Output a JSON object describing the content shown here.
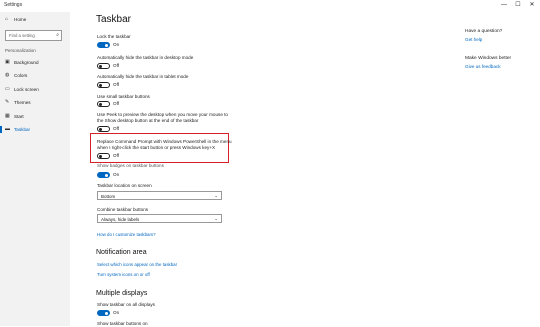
{
  "window": {
    "title": "Settings",
    "minimize": "—",
    "maximize": "☐",
    "close": "✕"
  },
  "sidebar": {
    "home": {
      "icon": "home-icon",
      "label": "Home"
    },
    "search_placeholder": "Find a setting",
    "section": "Personalization",
    "items": [
      {
        "icon": "picture-icon",
        "label": "Background"
      },
      {
        "icon": "palette-icon",
        "label": "Colors"
      },
      {
        "icon": "monitor-icon",
        "label": "Lock screen"
      },
      {
        "icon": "brush-icon",
        "label": "Themes"
      },
      {
        "icon": "start-icon",
        "label": "Start"
      },
      {
        "icon": "taskbar-icon",
        "label": "Taskbar"
      }
    ],
    "active": "Taskbar"
  },
  "main": {
    "title": "Taskbar",
    "settings": [
      {
        "label": "Lock the taskbar",
        "state": "On"
      },
      {
        "label": "Automatically hide the taskbar in desktop mode",
        "state": "Off"
      },
      {
        "label": "Automatically hide the taskbar in tablet mode",
        "state": "Off"
      },
      {
        "label": "Use small taskbar buttons",
        "state": "Off"
      },
      {
        "label_1": "Use Peek to preview the desktop when you move your mouse to",
        "label_2": "the Show desktop button at the end of the taskbar",
        "state": "Off"
      },
      {
        "label_1": "Replace Command Prompt with Windows PowerShell in the menu",
        "label_2": "when I right-click the start button or press Windows key+X",
        "state": "Off"
      },
      {
        "label": "Show badges on taskbar buttons",
        "state": "On"
      }
    ],
    "location_label": "Taskbar location on screen",
    "location_value": "Bottom",
    "combine_label": "Combine taskbar buttons",
    "combine_value": "Always, hide labels",
    "customize_link": "How do I customize taskbars?",
    "notification_heading": "Notification area",
    "notif_link_1": "Select which icons appear on the taskbar",
    "notif_link_2": "Turn system icons on or off",
    "multiple_heading": "Multiple displays",
    "show_all_label": "Show taskbar on all displays",
    "show_all_state": "On",
    "show_buttons_label": "Show taskbar buttons on"
  },
  "right": {
    "question": "Have a question?",
    "get_help": "Get help",
    "better": "Make Windows better",
    "feedback": "Give us feedback"
  },
  "colors": {
    "accent": "#0067c0",
    "highlight": "#d42026",
    "sidebar_bg": "#f2f2f2"
  }
}
